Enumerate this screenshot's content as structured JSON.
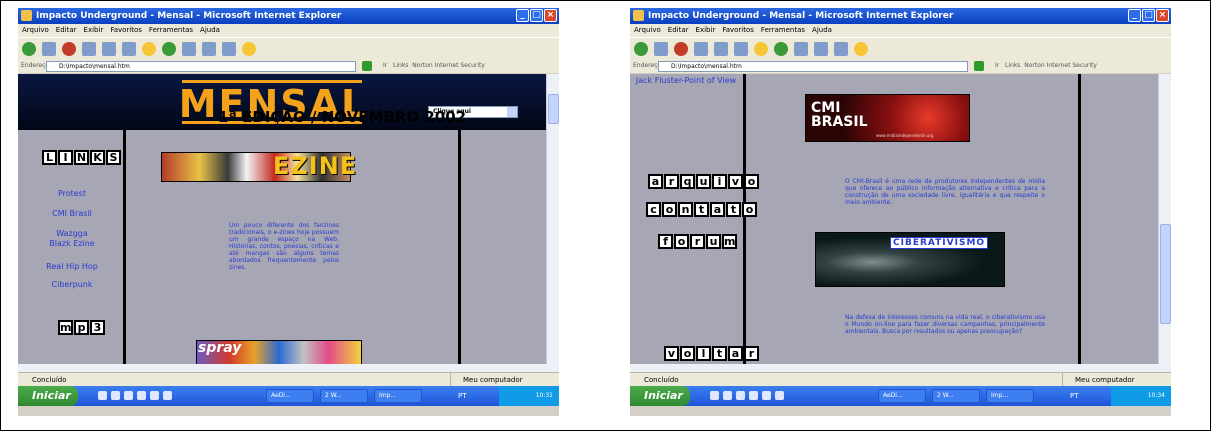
{
  "browser1": {
    "title": "Impacto Underground - Mensal - Microsoft Internet Explorer",
    "menu": [
      "Arquivo",
      "Editar",
      "Exibir",
      "Favoritos",
      "Ferramentas",
      "Ajuda"
    ],
    "address_label": "Endereço",
    "address": "D:\\Impacto\\mensal.htm",
    "go_label": "Ir",
    "links_label": "Links",
    "norton": "Norton Internet Security",
    "status": "Concluído",
    "zone": "Meu computador",
    "page": {
      "banner_title": "MENSAL",
      "select_value": "Clique aqui",
      "edition": "1ª EDIÇÃO / NOVEMBRO 2002",
      "links_logo": [
        "L",
        "I",
        "N",
        "K",
        "S"
      ],
      "nav_links": [
        "Protest",
        "CMI Brasil",
        "Wazgga Blazk Ezine",
        "Real Hip Hop",
        "Ciberpunk"
      ],
      "mp3_logo": [
        "m",
        "p",
        "3"
      ],
      "ezine_text": "EZINE",
      "ezine_paragraph": "Um pouco diferente dos fanzines tradicionais, o e-zines hoje possuem um grande espaço na Web. Histórias, contos, poesias, críticas e até mangas são alguns temas abordados frequentemente pelos zines.",
      "spray_text": "spray"
    }
  },
  "browser2": {
    "title": "Impacto Underground - Mensal - Microsoft Internet Explorer",
    "menu": [
      "Arquivo",
      "Editar",
      "Exibir",
      "Favoritos",
      "Ferramentas",
      "Ajuda"
    ],
    "address_label": "Endereço",
    "address": "D:\\Impacto\\mensal.htm",
    "go_label": "Ir",
    "links_label": "Links",
    "norton": "Norton Internet Security",
    "status": "Concluído",
    "zone": "Meu computador",
    "page": {
      "jack_link": "Jack Fluster-Point of View",
      "arquivo_logo": [
        "a",
        "r",
        "q",
        "u",
        "i",
        "v",
        "o"
      ],
      "contato_logo": [
        "c",
        "o",
        "n",
        "t",
        "a",
        "t",
        "o"
      ],
      "forum_logo": [
        "f",
        "o",
        "r",
        "u",
        "m"
      ],
      "voltar_logo": [
        "v",
        "o",
        "l",
        "t",
        "a",
        "r"
      ],
      "cmi_title": "CMI BRASIL",
      "cmi_url": "www.midiaindependente.org",
      "cmi_paragraph": "O CMI-Brasil é uma rede de produtores independentes de mídia que oferece ao público informação alternativa e crítica para a construção de uma sociedade livre, igualitária e que respeite o meio ambiente.",
      "ciber_title": "CIBERATIVISMO",
      "ciber_paragraph": "Na defesa de interesses comuns na vida real, o ciberativismo usa o Mundo on-line para fazer diversas campanhas, principalmente ambientais. Busca por resultados ou apenas preocupação?"
    }
  },
  "taskbar1": {
    "start": "Iniciar",
    "tasks": [
      "AeDi...",
      "2 W...",
      "Imp..."
    ],
    "lang": "PT",
    "clock": "10:31"
  },
  "taskbar2": {
    "start": "Iniciar",
    "tasks": [
      "AeDi...",
      "2 W...",
      "Imp..."
    ],
    "lang": "PT",
    "clock": "10:34"
  }
}
